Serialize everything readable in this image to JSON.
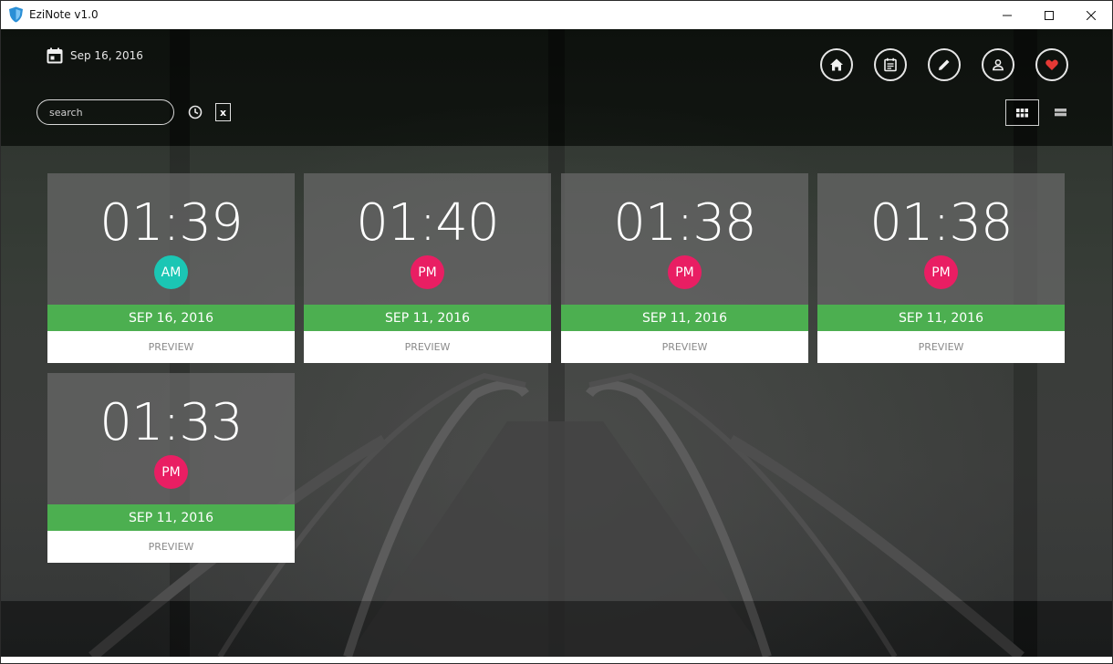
{
  "window": {
    "title": "EziNote v1.0"
  },
  "header": {
    "date": "Sep 16, 2016",
    "search": {
      "placeholder": "search",
      "value": ""
    },
    "clear_label": "x"
  },
  "nav": [
    {
      "name": "home",
      "icon": "home-icon"
    },
    {
      "name": "calendar",
      "icon": "calendar-icon"
    },
    {
      "name": "edit",
      "icon": "pencil-icon"
    },
    {
      "name": "profile",
      "icon": "user-icon"
    },
    {
      "name": "favorites",
      "icon": "heart-icon"
    }
  ],
  "colors": {
    "am": "#1bc6b4",
    "pm": "#e91e63",
    "date_bar": "#4caf50",
    "heart": "#e53935"
  },
  "notes": [
    {
      "time": "01:39",
      "period": "AM",
      "date": "SEP 16, 2016",
      "preview": "PREVIEW"
    },
    {
      "time": "01:40",
      "period": "PM",
      "date": "SEP 11, 2016",
      "preview": "PREVIEW"
    },
    {
      "time": "01:38",
      "period": "PM",
      "date": "SEP 11, 2016",
      "preview": "PREVIEW"
    },
    {
      "time": "01:38",
      "period": "PM",
      "date": "SEP 11, 2016",
      "preview": "PREVIEW"
    },
    {
      "time": "01:33",
      "period": "PM",
      "date": "SEP 11, 2016",
      "preview": "PREVIEW"
    }
  ]
}
